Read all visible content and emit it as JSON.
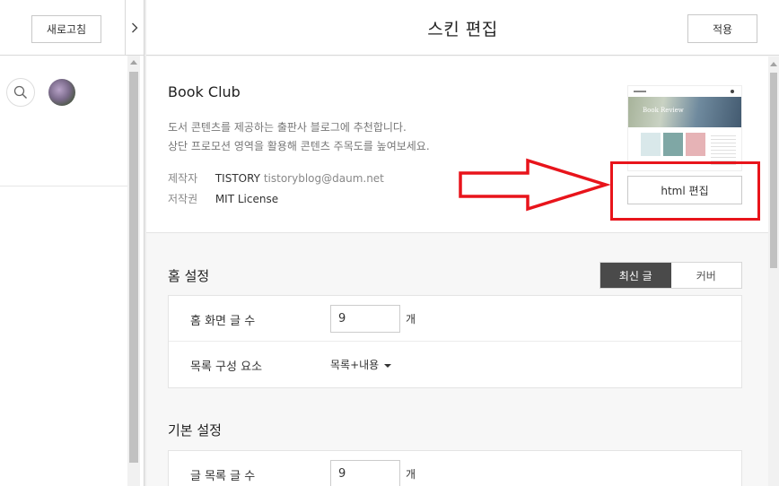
{
  "left_panel": {
    "refresh_label": "새로고침",
    "collapse_icon": "chevron-right-icon",
    "search_icon": "search-icon"
  },
  "header": {
    "title": "스킨 편집",
    "apply_label": "적용"
  },
  "skin": {
    "name": "Book Club",
    "description_lines": [
      "도서 콘텐츠를 제공하는 출판사 블로그에 추천합니다.",
      "상단 프로모션 영역을 활용해 콘텐츠 주목도를 높여보세요."
    ],
    "maker_label": "제작자",
    "maker_name": "TISTORY",
    "maker_email": "tistoryblog@daum.net",
    "license_label": "저작권",
    "license_value": "MIT License",
    "preview_hero_text": "Book Review",
    "html_edit_label": "html 편집"
  },
  "home_settings": {
    "title": "홈 설정",
    "tabs": [
      {
        "label": "최신 글",
        "active": true
      },
      {
        "label": "커버",
        "active": false
      }
    ],
    "rows": [
      {
        "label": "홈 화면 글 수",
        "value": "9",
        "unit": "개"
      },
      {
        "label": "목록 구성 요소",
        "select_value": "목록+내용"
      }
    ]
  },
  "basic_settings": {
    "title": "기본 설정",
    "rows": [
      {
        "label": "글 목록 글 수",
        "value": "9",
        "unit": "개"
      }
    ]
  },
  "colors": {
    "highlight": "#e8141b",
    "active_tab": "#4a4a4a"
  }
}
